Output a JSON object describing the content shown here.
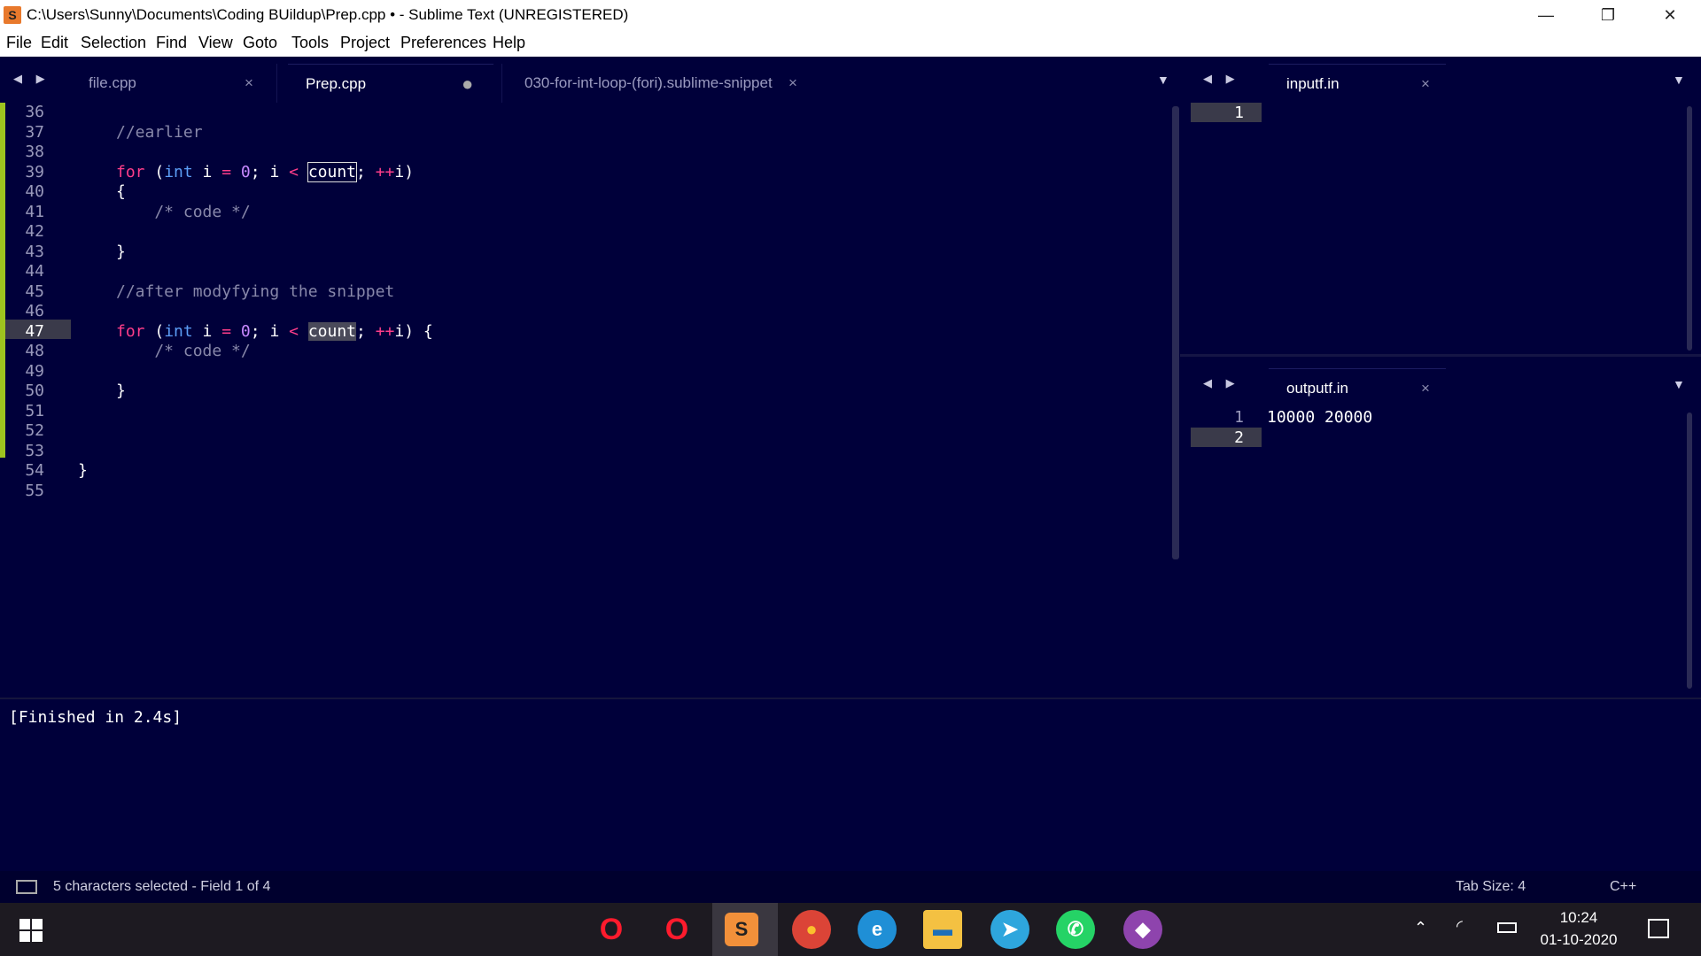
{
  "window": {
    "title": "C:\\Users\\Sunny\\Documents\\Coding BUildup\\Prep.cpp • - Sublime Text (UNREGISTERED)",
    "minimize": "—",
    "restore": "❐",
    "close": "✕"
  },
  "menu": [
    "File",
    "Edit",
    "Selection",
    "Find",
    "View",
    "Goto",
    "Tools",
    "Project",
    "Preferences",
    "Help"
  ],
  "left_group": {
    "arrows": "◀ ▶",
    "tabs": [
      {
        "label": "file.cpp",
        "close": "×"
      },
      {
        "label": "Prep.cpp",
        "close": "●"
      },
      {
        "label": "030-for-int-loop-(fori).sublime-snippet",
        "close": "×"
      }
    ],
    "dropdown": "▼"
  },
  "code": {
    "lines": [
      {
        "n": "36"
      },
      {
        "n": "37",
        "comment": "//earlier"
      },
      {
        "n": "38"
      },
      {
        "n": "39",
        "for": "for",
        "paren": " (",
        "type": "int",
        "mid1": " i ",
        "eq": "=",
        "sp": " ",
        "zero": "0",
        "mid2": "; i ",
        "lt": "<",
        "sp2": " ",
        "count": "count",
        "semi": "; ",
        "inc": "++",
        "tail": "i)"
      },
      {
        "n": "40",
        "text": "{"
      },
      {
        "n": "41",
        "comment": "    /* code */"
      },
      {
        "n": "42"
      },
      {
        "n": "43",
        "text": "}"
      },
      {
        "n": "44"
      },
      {
        "n": "45",
        "comment": "//after modyfying the snippet"
      },
      {
        "n": "46"
      },
      {
        "n": "47",
        "for": "for",
        "paren": " (",
        "type": "int",
        "mid1": " i ",
        "eq": "=",
        "sp": " ",
        "zero": "0",
        "mid2": "; i ",
        "lt": "<",
        "sp2": " ",
        "count": "count",
        "semi": "; ",
        "inc": "++",
        "tail": "i) {"
      },
      {
        "n": "48",
        "comment": "    /* code */"
      },
      {
        "n": "49"
      },
      {
        "n": "50",
        "text": "}"
      },
      {
        "n": "51"
      },
      {
        "n": "52"
      },
      {
        "n": "53"
      },
      {
        "n": "54",
        "text": "}"
      },
      {
        "n": "55"
      }
    ]
  },
  "input_pane": {
    "arrows": "◀ ▶",
    "tab": "inputf.in",
    "close": "×",
    "dropdown": "▼",
    "lines": [
      {
        "n": "1",
        "text": ""
      }
    ]
  },
  "output_pane": {
    "arrows": "◀ ▶",
    "tab": "outputf.in",
    "close": "×",
    "dropdown": "▼",
    "lines": [
      {
        "n": "1",
        "text": "10000 20000"
      },
      {
        "n": "2",
        "text": ""
      }
    ]
  },
  "build_output": "[Finished in 2.4s]",
  "status": {
    "message": "5 characters selected - Field 1 of 4",
    "tab_size": "Tab Size: 4",
    "syntax": "C++"
  },
  "taskbar": {
    "apps": [
      {
        "icon": "opera-icon",
        "glyph": "O"
      },
      {
        "icon": "opera-gx-icon",
        "glyph": "O"
      },
      {
        "icon": "sublime-text-icon",
        "glyph": "S"
      },
      {
        "icon": "chrome-icon",
        "glyph": "●"
      },
      {
        "icon": "edge-icon",
        "glyph": "e"
      },
      {
        "icon": "file-explorer-icon",
        "glyph": "▬"
      },
      {
        "icon": "telegram-icon",
        "glyph": "➤"
      },
      {
        "icon": "whatsapp-icon",
        "glyph": "✆"
      },
      {
        "icon": "github-icon",
        "glyph": "◆"
      }
    ],
    "time": "10:24",
    "date": "01-10-2020"
  },
  "colors": {
    "bg": "#00003a",
    "keyword": "#ff3d8a",
    "type": "#5c9ef7",
    "number": "#c889ff",
    "comment": "#8888aa",
    "modified_gutter": "#9ec41f"
  }
}
